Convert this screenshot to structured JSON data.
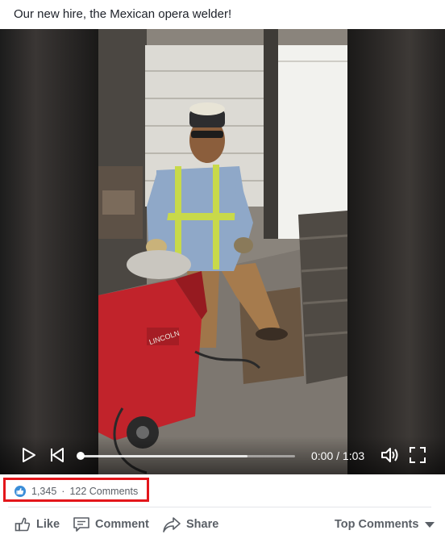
{
  "post": {
    "caption": "Our new hire, the Mexican opera welder!"
  },
  "video": {
    "time_display": "0:00 / 1:03",
    "progress": 0.0,
    "buffered": 0.78,
    "icons": {
      "play": "play-icon",
      "previous": "skip-back-icon",
      "volume": "volume-icon",
      "fullscreen": "fullscreen-icon"
    }
  },
  "stats": {
    "reactions": "1,345",
    "separator": "·",
    "comments": "122 Comments",
    "highlight_color": "#e3161b",
    "reaction_color": "#3b8ed8"
  },
  "actions": {
    "like": "Like",
    "comment": "Comment",
    "share": "Share",
    "sort": "Top Comments"
  }
}
